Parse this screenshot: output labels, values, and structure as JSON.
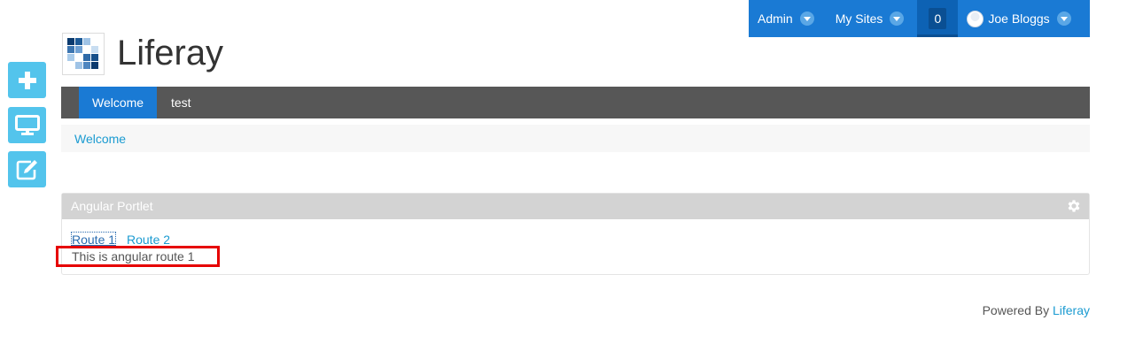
{
  "dockbar": {
    "admin_label": "Admin",
    "my_sites_label": "My Sites",
    "notification_count": "0",
    "user_name": "Joe Bloggs"
  },
  "side_controls": [
    {
      "icon": "plus-icon"
    },
    {
      "icon": "monitor-icon"
    },
    {
      "icon": "edit-icon"
    }
  ],
  "header": {
    "site_title": "Liferay"
  },
  "navigation": {
    "tabs": [
      {
        "label": "Welcome",
        "active": true
      },
      {
        "label": "test",
        "active": false
      }
    ]
  },
  "breadcrumb": {
    "items": [
      "Welcome"
    ]
  },
  "portlet": {
    "title": "Angular Portlet",
    "links": [
      "Route 1",
      "Route 2"
    ],
    "content": "This is angular route 1"
  },
  "footer": {
    "powered_by_text": "Powered By",
    "powered_by_link": "Liferay"
  },
  "colors": {
    "dockbar": "#1a7ad4",
    "nav_bar": "#575757",
    "nav_active": "#1a7ad4",
    "side_buttons": "#53c4ec",
    "link": "#1b9bd1",
    "highlight": "#e60000"
  }
}
